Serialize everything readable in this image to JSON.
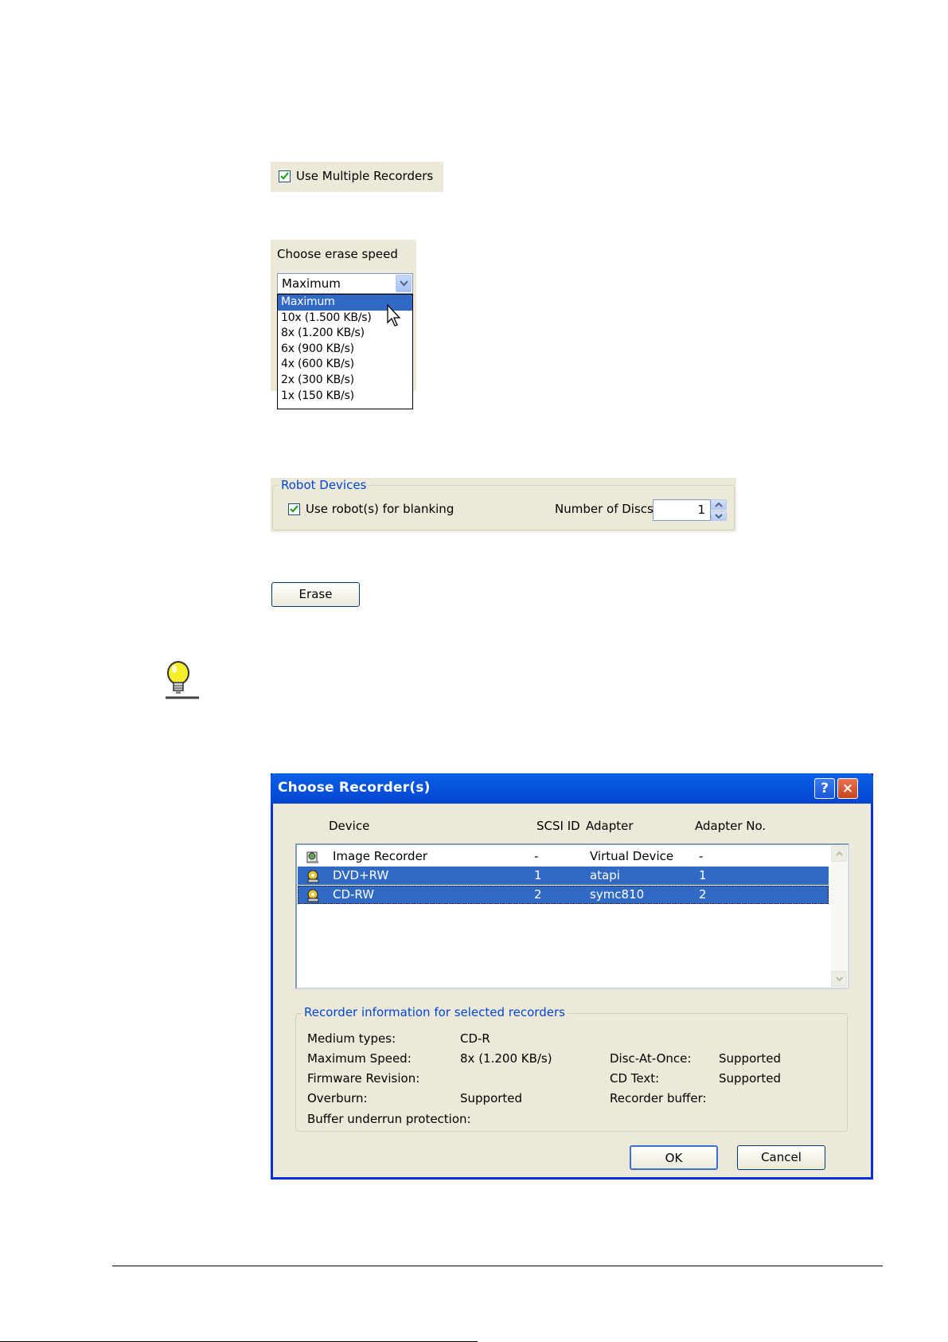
{
  "multi_recorders": {
    "label": "Use Multiple Recorders",
    "checked": true
  },
  "erase_speed": {
    "label": "Choose erase speed",
    "selected": "Maximum",
    "options": [
      "Maximum",
      "10x (1.500 KB/s)",
      "8x (1.200 KB/s)",
      "6x (900 KB/s)",
      "4x (600 KB/s)",
      "2x (300 KB/s)",
      "1x (150 KB/s)"
    ],
    "highlighted_option": "Maximum"
  },
  "robot": {
    "group_title": "Robot Devices",
    "use_robot_label": "Use robot(s) for blanking",
    "use_robot_checked": true,
    "discs_label": "Number of Discs",
    "discs_value": "1"
  },
  "erase_button": "Erase",
  "dialog": {
    "title": "Choose Recorder(s)",
    "help_glyph": "?",
    "close_glyph": "×",
    "columns": [
      "Device",
      "SCSI ID",
      "Adapter",
      "Adapter No."
    ],
    "rows": [
      {
        "device": "Image Recorder",
        "scsi": "-",
        "adapter": "Virtual Device",
        "adapter_no": "-",
        "selected": false,
        "icon": "image-recorder-icon"
      },
      {
        "device": "DVD+RW",
        "scsi": "1",
        "adapter": "atapi",
        "adapter_no": "1",
        "selected": true,
        "icon": "disc-drive-icon"
      },
      {
        "device": "CD-RW",
        "scsi": "2",
        "adapter": "symc810",
        "adapter_no": "2",
        "selected": true,
        "icon": "disc-drive-icon"
      }
    ],
    "info_title": "Recorder information for selected recorders",
    "info": {
      "medium_types_label": "Medium types:",
      "medium_types_value": "CD-R",
      "max_speed_label": "Maximum Speed:",
      "max_speed_value": "8x (1.200 KB/s)",
      "firmware_label": "Firmware Revision:",
      "firmware_value": "",
      "overburn_label": "Overburn:",
      "overburn_value": "Supported",
      "buffer_label": "Buffer underrun protection:",
      "buffer_value": "",
      "dao_label": "Disc-At-Once:",
      "dao_value": "Supported",
      "cdtext_label": "CD Text:",
      "cdtext_value": "Supported",
      "recbuf_label": "Recorder buffer:",
      "recbuf_value": ""
    },
    "ok": "OK",
    "cancel": "Cancel"
  },
  "colors": {
    "xp_panel": "#ece9d8",
    "selection": "#316ac5",
    "group_title": "#0046d5",
    "titlebar": "#0855dd"
  }
}
